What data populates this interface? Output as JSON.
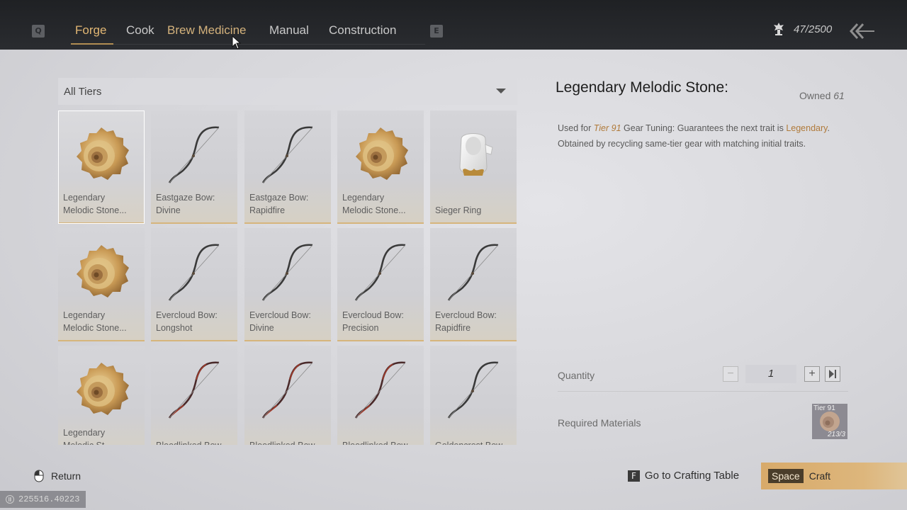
{
  "nav": {
    "prev_key": "Q",
    "next_key": "E",
    "tabs": [
      "Forge",
      "Cook",
      "Brew Medicine",
      "Manual",
      "Construction"
    ],
    "active_tab": "Forge",
    "currency_text": "47/2500"
  },
  "filter": {
    "label": "All Tiers"
  },
  "items": [
    {
      "name": "Legendary\nMelodic Stone...",
      "icon": "shell-icon",
      "selected": true
    },
    {
      "name": "Eastgaze Bow:\nDivine",
      "icon": "bow-icon"
    },
    {
      "name": "Eastgaze Bow:\nRapidfire",
      "icon": "bow-icon"
    },
    {
      "name": "Legendary\nMelodic Stone...",
      "icon": "shell-icon"
    },
    {
      "name": "Sieger Ring",
      "icon": "ring-icon"
    },
    {
      "name": "Legendary\nMelodic Stone...",
      "icon": "shell-icon"
    },
    {
      "name": "Evercloud Bow:\nLongshot",
      "icon": "bow-icon"
    },
    {
      "name": "Evercloud Bow:\nDivine",
      "icon": "bow-icon"
    },
    {
      "name": "Evercloud Bow:\nPrecision",
      "icon": "bow-icon"
    },
    {
      "name": "Evercloud Bow:\nRapidfire",
      "icon": "bow-icon"
    },
    {
      "name": "Legendary\nMelodic St...",
      "icon": "shell-icon"
    },
    {
      "name": "Bloodlinked Bow -",
      "icon": "bow-red-icon"
    },
    {
      "name": "Bloodlinked Bow -",
      "icon": "bow-red-icon"
    },
    {
      "name": "Bloodlinked Bow -",
      "icon": "bow-red-icon"
    },
    {
      "name": "Goldencrest Bow -",
      "icon": "bow-icon"
    }
  ],
  "detail": {
    "title": "Legendary Melodic Stone:",
    "owned_label": "Owned",
    "owned_count": "61",
    "desc_used_for": "Used for",
    "desc_tier": "Tier 91",
    "desc_mid": "Gear Tuning: Guarantees the next trait is",
    "desc_legendary": "Legendary",
    "desc_end": ".",
    "desc_line2": "Obtained by recycling same-tier gear with matching initial traits.",
    "quantity_label": "Quantity",
    "quantity_value": "1",
    "required_label": "Required Materials",
    "material": {
      "tier": "Tier 91",
      "count": "213/3",
      "icon": "shell-icon"
    }
  },
  "footer": {
    "return_label": "Return",
    "goto_key": "F",
    "goto_label": "Go to Crafting Table",
    "craft_key": "Space",
    "craft_label": "Craft",
    "uid": "225516.40223"
  },
  "colors": {
    "accent_gold": "#e2b774",
    "text_gold": "#b07a3a",
    "topbar": "#1f2124"
  }
}
